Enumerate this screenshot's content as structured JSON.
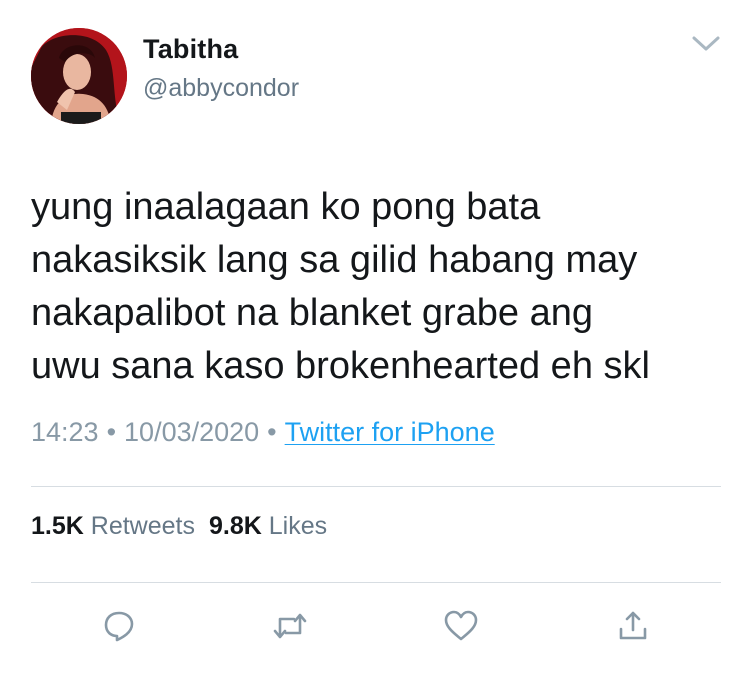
{
  "user": {
    "display_name": "Tabitha",
    "handle": "@abbycondor"
  },
  "tweet": {
    "text": "yung inaalagaan ko pong bata\nnakasiksik lang sa gilid habang may\nnakapalibot na blanket grabe ang\nuwu sana kaso brokenhearted eh skl"
  },
  "meta": {
    "time": "14:23",
    "separator": "•",
    "date": "10/03/2020",
    "source": "Twitter for iPhone"
  },
  "stats": {
    "retweets_count": "1.5K",
    "retweets_label": "Retweets",
    "likes_count": "9.8K",
    "likes_label": "Likes"
  },
  "icons": {
    "menu": "chevron-down-icon",
    "reply": "reply-icon",
    "retweet": "retweet-icon",
    "like": "heart-icon",
    "share": "share-icon"
  },
  "colors": {
    "text": "#14171a",
    "secondary": "#657786",
    "meta": "#8899a6",
    "link": "#1da1f2",
    "icon": "#8899a6",
    "divider": "#d7dde2",
    "avatar_bg": "#b3141b"
  }
}
